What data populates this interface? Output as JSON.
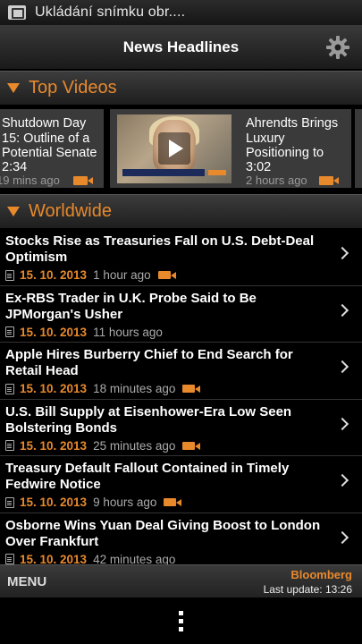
{
  "status_bar": {
    "notification_text": "Ukládání snímku obr...."
  },
  "header": {
    "title": "News Headlines",
    "settings_icon": "gear-icon"
  },
  "top_videos": {
    "heading": "Top Videos",
    "items": [
      {
        "title": "Shutdown Day 15: Outline of a Potential Senate",
        "duration": "2:34",
        "age": "19 mins ago"
      },
      {
        "title": "Ahrendts Brings Luxury Positioning to",
        "duration": "3:02",
        "age": "2 hours ago"
      }
    ]
  },
  "worldwide": {
    "heading": "Worldwide",
    "items": [
      {
        "headline": "Stocks Rise as Treasuries Fall on U.S. Debt-Deal Optimism",
        "date": "15. 10. 2013",
        "age": "1 hour ago",
        "video": true
      },
      {
        "headline": "Ex-RBS Trader in U.K. Probe Said to Be JPMorgan's Usher",
        "date": "15. 10. 2013",
        "age": "11 hours ago",
        "video": false
      },
      {
        "headline": "Apple Hires Burberry Chief to End Search for Retail Head",
        "date": "15. 10. 2013",
        "age": "18 minutes ago",
        "video": true
      },
      {
        "headline": "U.S. Bill Supply at Eisenhower-Era Low Seen Bolstering Bonds",
        "date": "15. 10. 2013",
        "age": "25 minutes ago",
        "video": true
      },
      {
        "headline": "Treasury Default Fallout Contained in Timely Fedwire Notice",
        "date": "15. 10. 2013",
        "age": "9 hours ago",
        "video": true
      },
      {
        "headline": "Osborne Wins Yuan Deal Giving Boost to London Over Frankfurt",
        "date": "15. 10. 2013",
        "age": "42 minutes ago",
        "video": false
      }
    ]
  },
  "footer": {
    "menu_label": "MENU",
    "brand": "Bloomberg",
    "last_update": "Last update: 13:26"
  },
  "colors": {
    "accent": "#e8892c",
    "background": "#000000"
  }
}
